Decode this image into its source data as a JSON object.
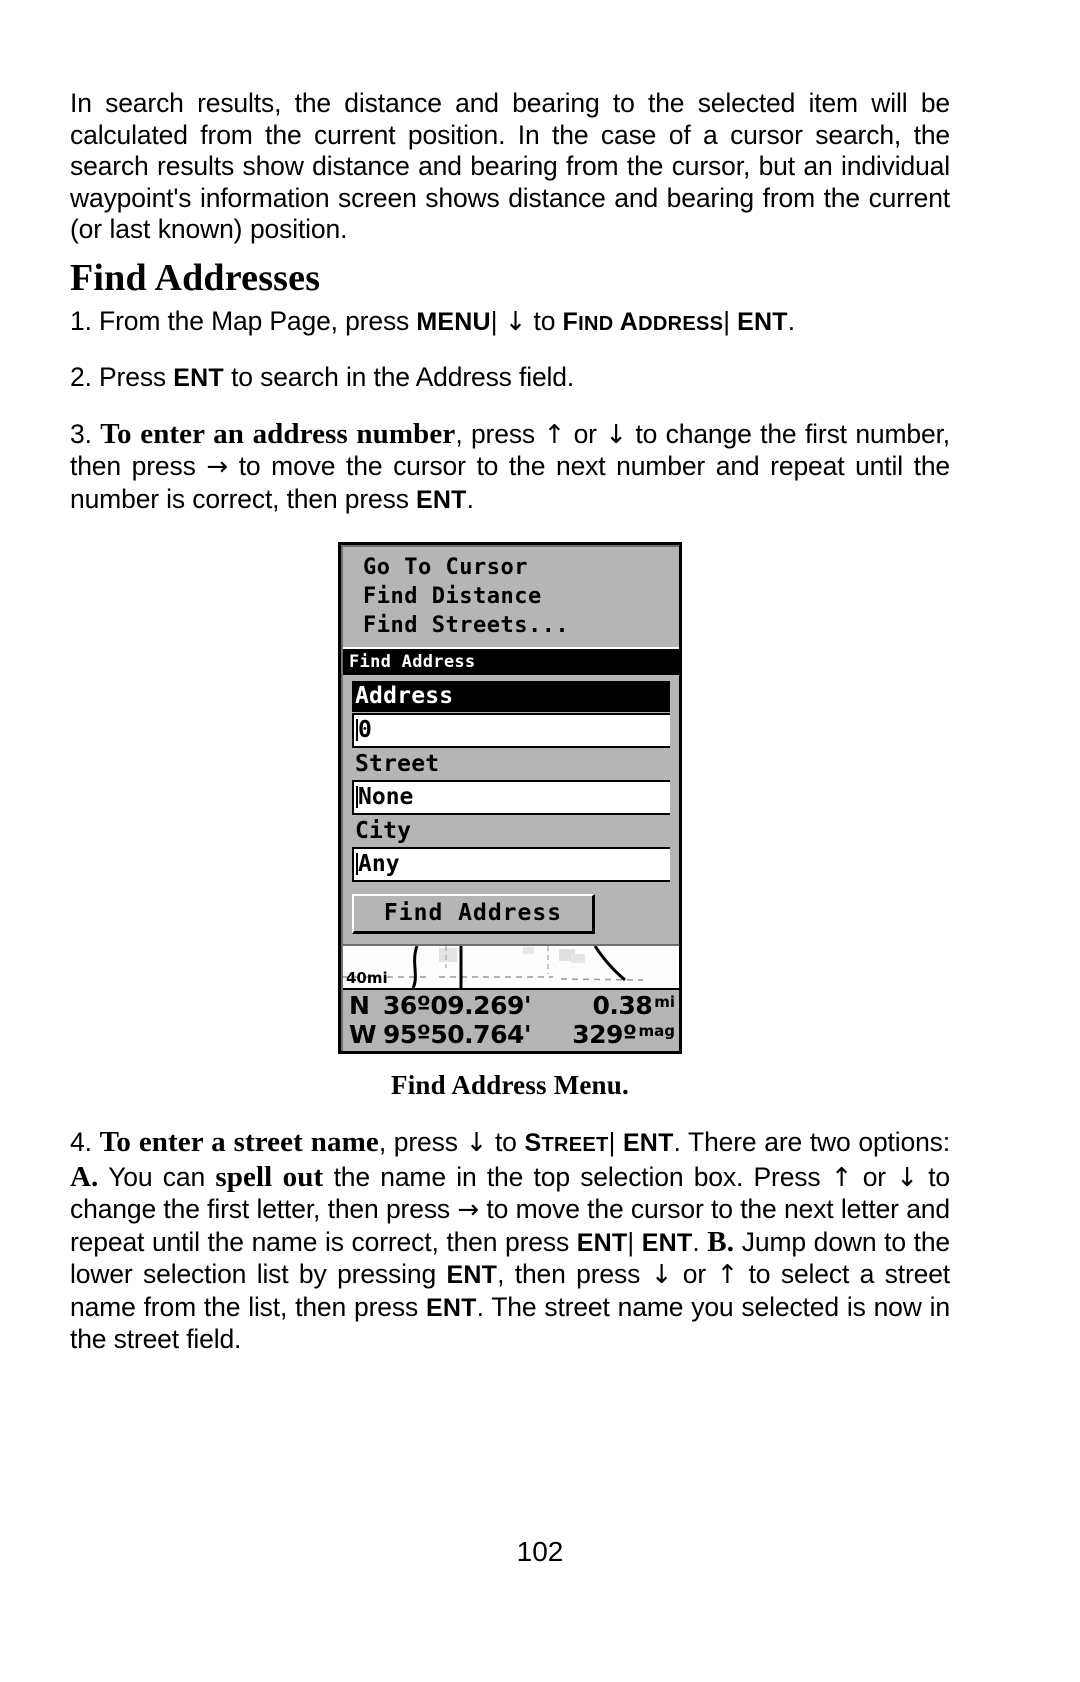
{
  "page": {
    "number": "102"
  },
  "intro": {
    "text": "In search results, the distance and bearing to the selected item will be calculated from the current position. In the case of a cursor search, the search results show distance and bearing from the cursor, but an individual waypoint's information screen shows distance and bearing from the current (or last known) position."
  },
  "heading": {
    "title": "Find Addresses"
  },
  "steps": {
    "step1": {
      "number": "1.",
      "pre": "From the Map Page, press",
      "key_menu": "MENU",
      "sep1": "|",
      "arrow_down": "↓",
      "mid": "to",
      "target_first": "F",
      "target_rest": "IND",
      "target_second": "A",
      "target_rest2": "DDRESS",
      "sep2": "|",
      "key_ent": "ENT",
      "end": "."
    },
    "step2": {
      "number": "2.",
      "pre": "Press",
      "key_ent": "ENT",
      "post": "to search in the Address field."
    },
    "step3": {
      "number": "3.",
      "bold_lead": "To enter an address number",
      "part1": ", press",
      "arrow_up": "↑",
      "or": "or",
      "arrow_down": "↓",
      "part2": "to change the first number, then press",
      "arrow_right": "→",
      "part3": "to move the cursor to the next number and repeat until the number is correct, then press",
      "key_ent": "ENT",
      "end": "."
    },
    "step4": {
      "number": "4.",
      "bold_lead": "To enter a street name",
      "part1": ", press",
      "arrow_down": "↓",
      "part2": "to",
      "target_first": "S",
      "target_rest": "TREET",
      "sep1": "|",
      "key_ent1": "ENT",
      "part3": ". There are two options:",
      "bold_a": "A.",
      "part4": "You can",
      "bold_spell": "spell out",
      "part5": "the name in the top selection box. Press",
      "arrow_up": "↑",
      "or": "or",
      "arrow_down2": "↓",
      "part6": "to change the first letter, then press",
      "arrow_right": "→",
      "part7": "to move the cursor to the next letter and repeat until the name is correct, then press",
      "key_ent2": "ENT",
      "sep2": "|",
      "key_ent3": "ENT",
      "part8": ".",
      "bold_b": "B.",
      "part9": "Jump down to the lower selection list by pressing",
      "key_ent4": "ENT",
      "part10": ", then press",
      "arrow_down3": "↓",
      "or2": "or",
      "arrow_up2": "↑",
      "part11": "to select a street name from the list, then press",
      "key_ent5": "ENT",
      "part12": ". The street name you selected is now in the street field."
    }
  },
  "figure": {
    "caption": "Find Address Menu.",
    "menu_items": [
      "Go To Cursor",
      "Find Distance",
      "Find Streets..."
    ],
    "subwindow_title": "Find Address",
    "fields": [
      {
        "label": "Address",
        "value": "0",
        "highlighted": true
      },
      {
        "label": "Street",
        "value": "None",
        "highlighted": false
      },
      {
        "label": "City",
        "value": "Any",
        "highlighted": false
      }
    ],
    "button_label": "Find Address",
    "map_scale": "40mi",
    "status": {
      "lat_hemi": "N",
      "lat_value": "36º09.269'",
      "lon_hemi": "W",
      "lon_value": "95º50.764'",
      "distance_value": "0.38",
      "distance_unit": "mi",
      "bearing_value": "329º",
      "bearing_unit": "mag"
    },
    "colors": {
      "screen_gray": "#b5b5b5",
      "highlight_black": "#000000",
      "field_white": "#ffffff"
    }
  }
}
